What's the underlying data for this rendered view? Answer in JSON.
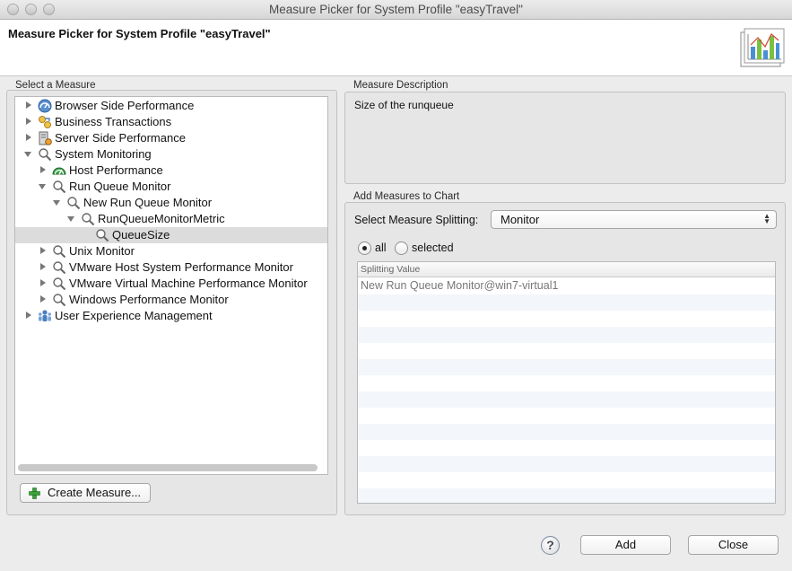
{
  "window": {
    "title": "Measure Picker for System Profile \"easyTravel\""
  },
  "header": {
    "title": "Measure Picker for System Profile \"easyTravel\"",
    "image_icon": "chart-icon"
  },
  "left_panel": {
    "group_label": "Select a Measure",
    "tree": [
      {
        "label": "Browser Side Performance",
        "icon": "gauge-icon"
      },
      {
        "label": "Business Transactions",
        "icon": "transactions-icon"
      },
      {
        "label": "Server Side Performance",
        "icon": "server-icon"
      },
      {
        "label": "System Monitoring",
        "icon": "magnifier-icon"
      },
      {
        "label": "Host Performance",
        "icon": "gauge-icon"
      },
      {
        "label": "Run Queue Monitor",
        "icon": "magnifier-icon"
      },
      {
        "label": "New Run Queue Monitor",
        "icon": "magnifier-icon"
      },
      {
        "label": "RunQueueMonitorMetric",
        "icon": "magnifier-icon"
      },
      {
        "label": "QueueSize",
        "icon": "magnifier-icon"
      },
      {
        "label": "Unix Monitor",
        "icon": "magnifier-icon"
      },
      {
        "label": "VMware Host System Performance Monitor",
        "icon": "magnifier-icon"
      },
      {
        "label": "VMware Virtual Machine Performance Monitor",
        "icon": "magnifier-icon"
      },
      {
        "label": "Windows Performance Monitor",
        "icon": "magnifier-icon"
      },
      {
        "label": "User Experience Management",
        "icon": "users-icon"
      }
    ],
    "create_button": "Create Measure..."
  },
  "description": {
    "group_label": "Measure Description",
    "text": "Size of the runqueue"
  },
  "add_measures": {
    "group_label": "Add Measures to Chart",
    "splitting_label": "Select Measure Splitting:",
    "splitting_value": "Monitor",
    "radio_all": "all",
    "radio_selected": "selected",
    "selected_radio": "all",
    "table": {
      "header": "Splitting Value",
      "rows": [
        "New Run Queue Monitor@win7-virtual1"
      ]
    }
  },
  "buttons": {
    "add": "Add",
    "close": "Close",
    "help": "?"
  },
  "colors": {
    "selection": "#dcdcdc",
    "plus_green": "#3aa33a"
  }
}
